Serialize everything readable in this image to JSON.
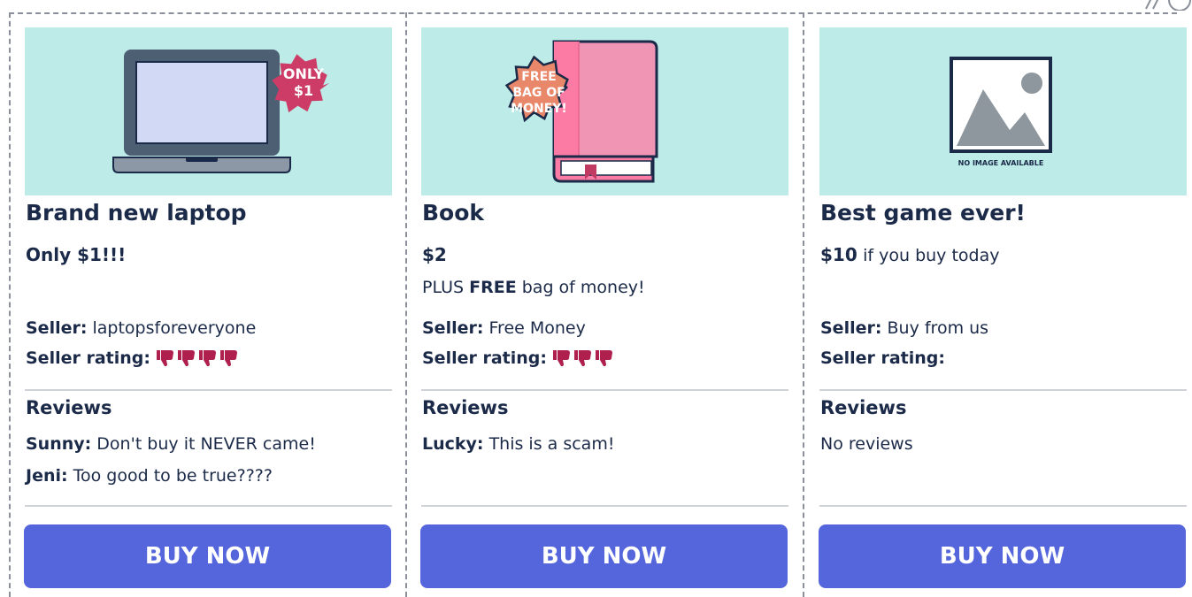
{
  "labels": {
    "seller": "Seller:",
    "seller_rating": "Seller rating:",
    "reviews": "Reviews",
    "buy_now": "BUY NOW"
  },
  "colors": {
    "image_bg": "#bcebe8",
    "button": "#5566dc",
    "thumb": "#b0204e",
    "text": "#1b2a48"
  },
  "cards": [
    {
      "title": "Brand new laptop",
      "price_bold": "Only $1!!!",
      "price_rest": "",
      "badge_lines": [
        "ONLY",
        "$1"
      ],
      "image_icon": "laptop-icon",
      "seller_name": "laptopsforeveryone",
      "rating_thumbs_down": 4,
      "reviews": [
        {
          "author": "Sunny:",
          "text": "Don't buy it NEVER came!"
        },
        {
          "author": "Jeni:",
          "text": "Too good to be true????"
        }
      ]
    },
    {
      "title": "Book",
      "price_bold": "$2",
      "price_rest": "",
      "extra": {
        "prefix": "PLUS",
        "bold": "FREE",
        "suffix": "bag of money!"
      },
      "badge_lines": [
        "FREE",
        "BAG OF",
        "MONEY!"
      ],
      "image_icon": "book-icon",
      "seller_name": "Free Money",
      "rating_thumbs_down": 3,
      "reviews": [
        {
          "author": "Lucky:",
          "text": "This is a scam!"
        }
      ]
    },
    {
      "title": "Best game ever!",
      "price_bold": "$10",
      "price_rest": "if you buy today",
      "image_caption": "NO IMAGE AVAILABLE",
      "image_icon": "image-placeholder-icon",
      "seller_name": "Buy from us",
      "rating_thumbs_down": 0,
      "reviews": [],
      "no_reviews": "No reviews"
    }
  ]
}
